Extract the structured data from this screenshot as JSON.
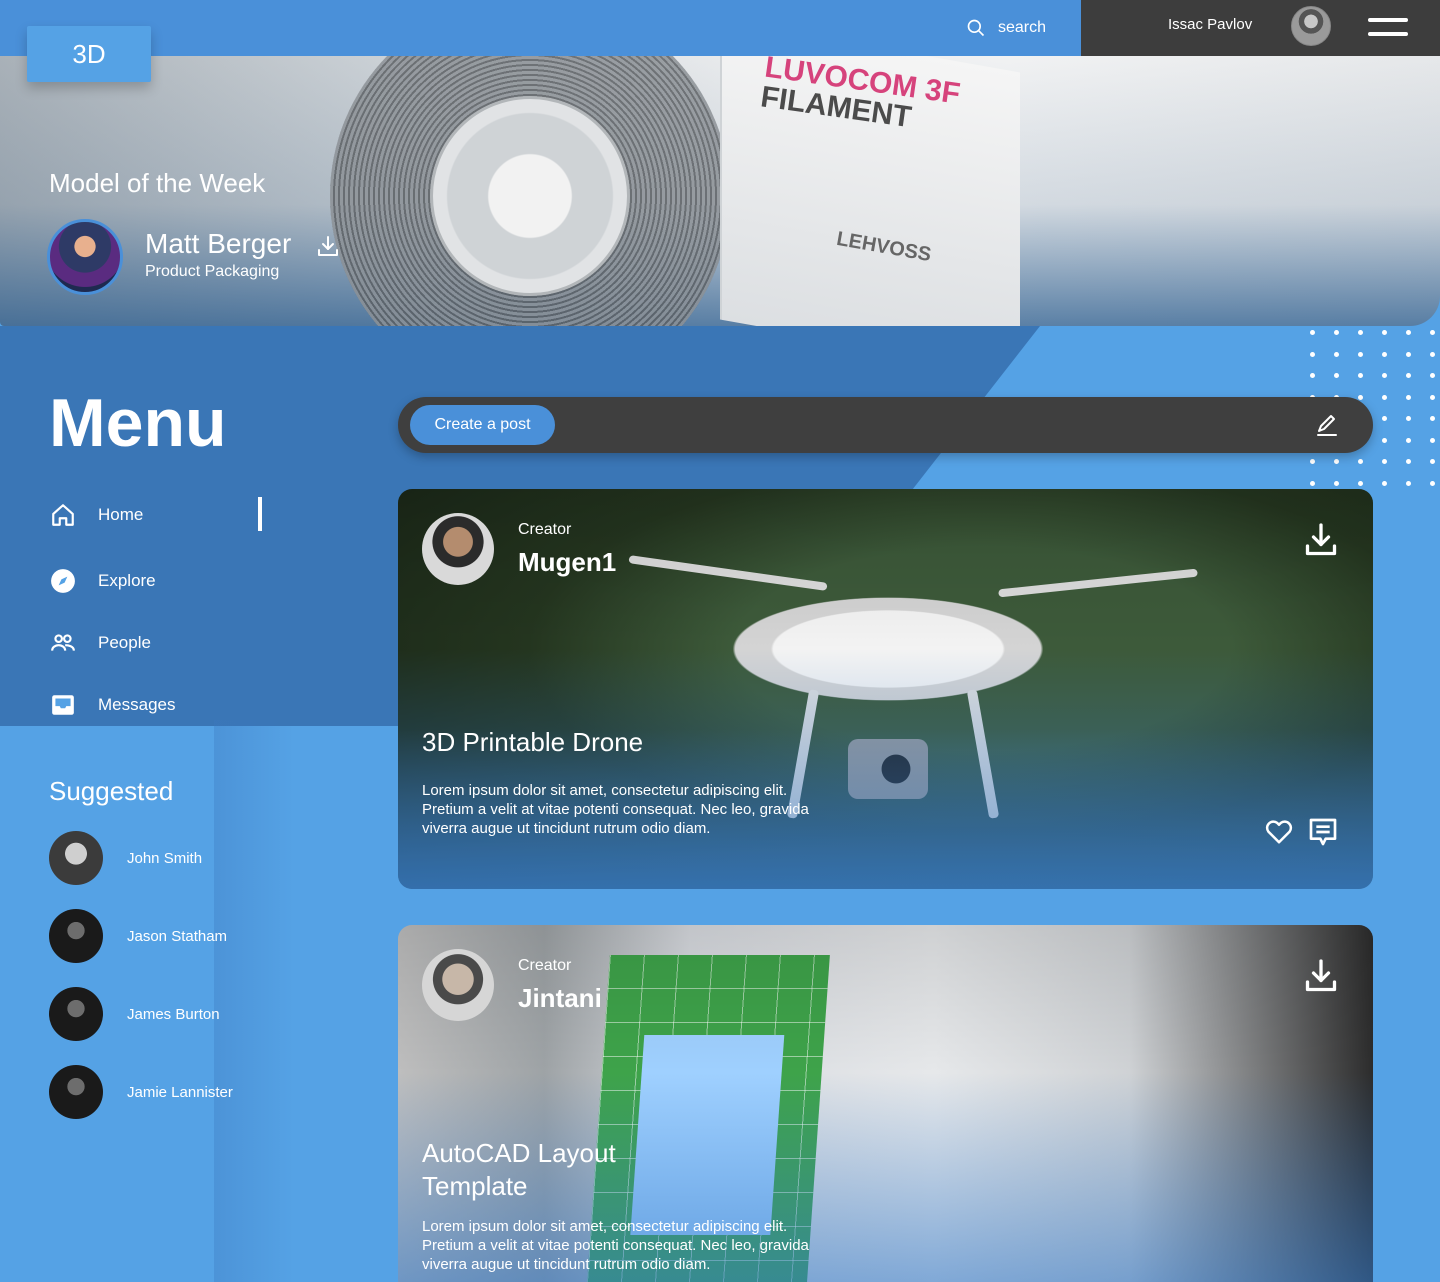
{
  "topbar": {
    "logo": "3D",
    "search_placeholder": "search",
    "user_name": "Issac Pavlov"
  },
  "hero": {
    "label": "Model of the Week",
    "featured_name": "Matt Berger",
    "featured_subtitle": "Product Packaging",
    "image_text_1": "LUVOCOM 3F",
    "image_text_2": "FILAMENT",
    "image_text_3": "LEHVOSS"
  },
  "sidebar": {
    "title": "Menu",
    "nav": [
      {
        "label": "Home",
        "icon": "home-icon",
        "active": true
      },
      {
        "label": "Explore",
        "icon": "compass-icon",
        "active": false
      },
      {
        "label": "People",
        "icon": "people-icon",
        "active": false
      },
      {
        "label": "Messages",
        "icon": "inbox-icon",
        "active": false
      }
    ],
    "suggested_title": "Suggested",
    "suggested": [
      {
        "name": "John Smith"
      },
      {
        "name": "Jason Statham"
      },
      {
        "name": "James Burton"
      },
      {
        "name": "Jamie Lannister"
      }
    ]
  },
  "post_bar": {
    "create_label": "Create a post"
  },
  "posts": [
    {
      "creator_label": "Creator",
      "creator_name": "Mugen1",
      "title": "3D Printable Drone",
      "description": "Lorem ipsum dolor sit amet, consectetur adipiscing elit. Pretium a velit at vitae potenti consequat. Nec leo, gravida viverra augue ut tincidunt rutrum odio diam."
    },
    {
      "creator_label": "Creator",
      "creator_name": "Jintani",
      "title": "AutoCAD Layout Template",
      "description": "Lorem ipsum dolor sit amet, consectetur adipiscing elit. Pretium a velit at vitae potenti consequat. Nec leo, gravida viverra augue ut tincidunt rutrum odio diam."
    }
  ],
  "colors": {
    "primary": "#4a90d9",
    "background": "#55a2e5",
    "dark": "#3d3d3d"
  }
}
